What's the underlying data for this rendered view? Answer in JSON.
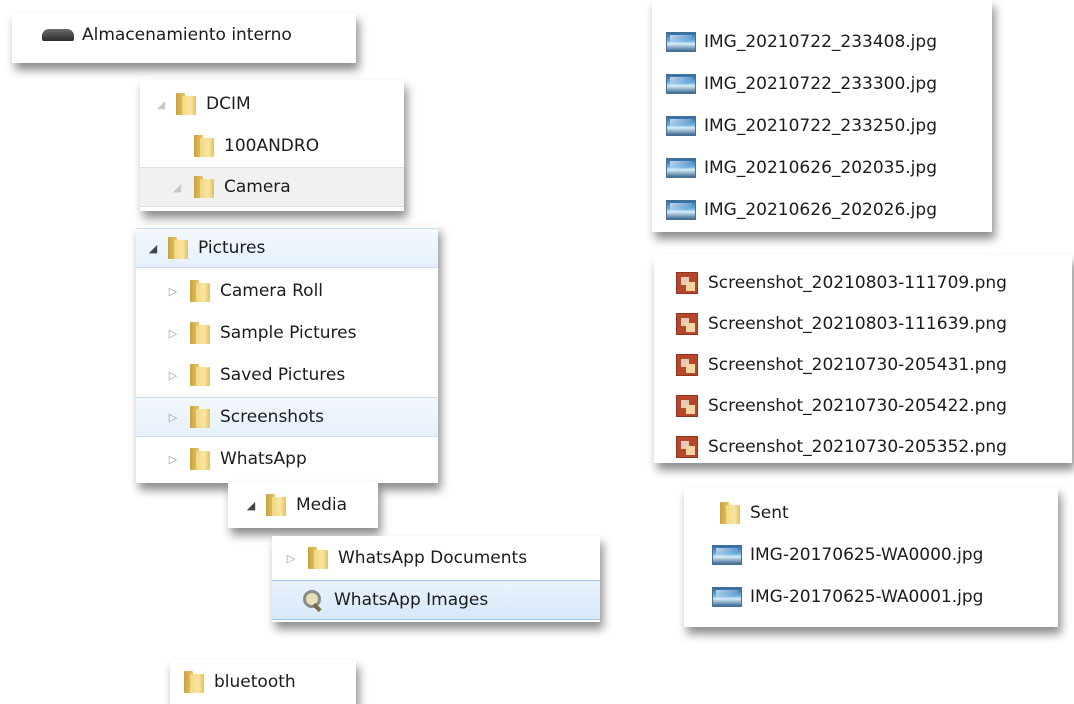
{
  "storage": {
    "label": "Almacenamiento interno"
  },
  "dcim_tree": [
    {
      "label": "DCIM",
      "expander": "open-faded"
    },
    {
      "label": "100ANDRO",
      "expander": "none"
    },
    {
      "label": "Camera",
      "expander": "open-faded"
    }
  ],
  "pictures_tree": [
    {
      "label": "Pictures",
      "expander": "open"
    },
    {
      "label": "Camera Roll",
      "expander": "closed"
    },
    {
      "label": "Sample Pictures",
      "expander": "closed"
    },
    {
      "label": "Saved Pictures",
      "expander": "closed"
    },
    {
      "label": "Screenshots",
      "expander": "closed"
    },
    {
      "label": "WhatsApp",
      "expander": "closed"
    }
  ],
  "media": {
    "label": "Media"
  },
  "whatsapp_subfolders": [
    {
      "label": "WhatsApp Documents"
    },
    {
      "label": "WhatsApp Images"
    }
  ],
  "bluetooth": {
    "label": "bluetooth"
  },
  "camera_files": [
    "IMG_20210722_233408.jpg",
    "IMG_20210722_233300.jpg",
    "IMG_20210722_233250.jpg",
    "IMG_20210626_202035.jpg",
    "IMG_20210626_202026.jpg"
  ],
  "screenshot_files": [
    "Screenshot_20210803-111709.png",
    "Screenshot_20210803-111639.png",
    "Screenshot_20210730-205431.png",
    "Screenshot_20210730-205422.png",
    "Screenshot_20210730-205352.png"
  ],
  "whatsapp_images_contents": {
    "folder": "Sent",
    "files": [
      "IMG-20170625-WA0000.jpg",
      "IMG-20170625-WA0001.jpg"
    ]
  },
  "icons": {
    "drive": "drive-icon",
    "folder": "folder-icon",
    "image": "image-file-icon",
    "png": "png-file-icon",
    "search_folder": "search-folder-icon",
    "expand_open": "◢",
    "expand_closed": "▷"
  }
}
